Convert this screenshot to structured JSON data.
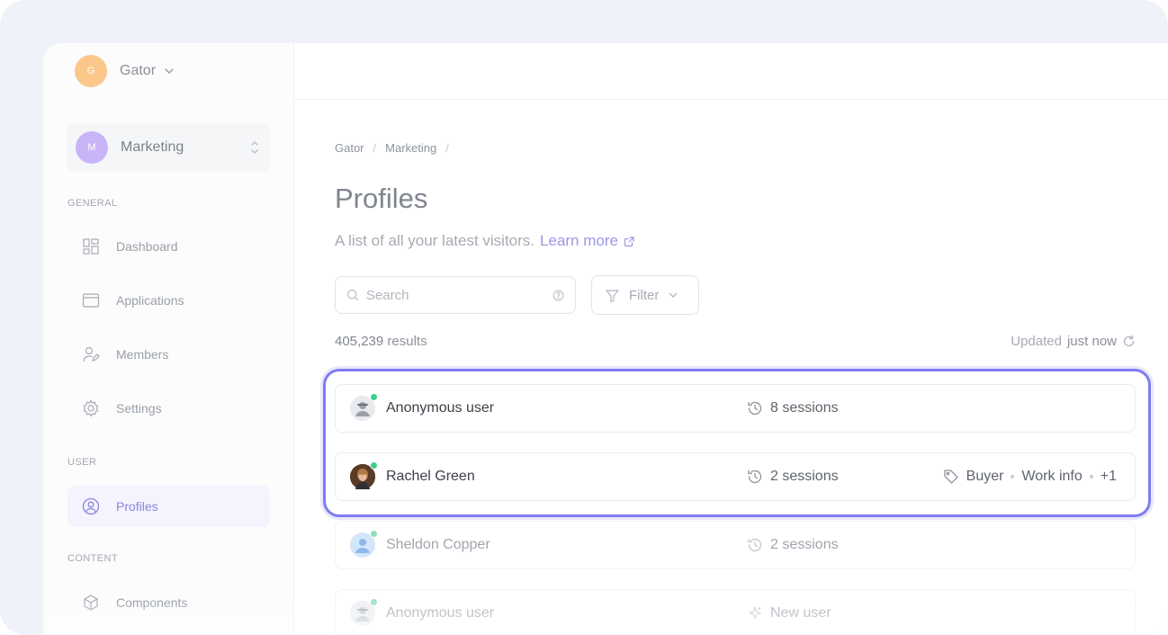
{
  "workspace": {
    "initial": "G",
    "name": "Gator"
  },
  "team": {
    "initial": "M",
    "name": "Marketing"
  },
  "sidebar": {
    "sections": [
      {
        "label": "GENERAL"
      },
      {
        "label": "USER"
      },
      {
        "label": "CONTENT"
      }
    ],
    "items": [
      {
        "label": "Dashboard",
        "icon": "dashboard-icon"
      },
      {
        "label": "Applications",
        "icon": "window-icon"
      },
      {
        "label": "Members",
        "icon": "user-edit-icon"
      },
      {
        "label": "Settings",
        "icon": "gear-icon"
      },
      {
        "label": "Profiles",
        "icon": "user-circle-icon",
        "active": true
      },
      {
        "label": "Components",
        "icon": "cube-icon"
      }
    ]
  },
  "breadcrumb": [
    "Gator",
    "Marketing",
    "/"
  ],
  "page": {
    "title": "Profiles",
    "subtitle": "A list of all your latest visitors.",
    "learn_more": "Learn more"
  },
  "search": {
    "placeholder": "Search"
  },
  "filter": {
    "label": "Filter"
  },
  "results": {
    "count": "405,239",
    "suffix": "results"
  },
  "updated": {
    "prefix": "Updated",
    "value": "just now"
  },
  "profiles": [
    {
      "name": "Anonymous user",
      "sessions": "8 sessions"
    },
    {
      "name": "Rachel Green",
      "sessions": "2 sessions",
      "tags": [
        "Buyer",
        "Work info",
        "+1"
      ]
    },
    {
      "name": "Sheldon Copper",
      "sessions": "2 sessions"
    },
    {
      "name": "Anonymous user",
      "sessions": "New user"
    }
  ],
  "colors": {
    "accent": "#7f7bf0",
    "online": "#3ecf8e",
    "workspace_avatar": "#fbc78b",
    "team_avatar": "#c9b4f7"
  }
}
